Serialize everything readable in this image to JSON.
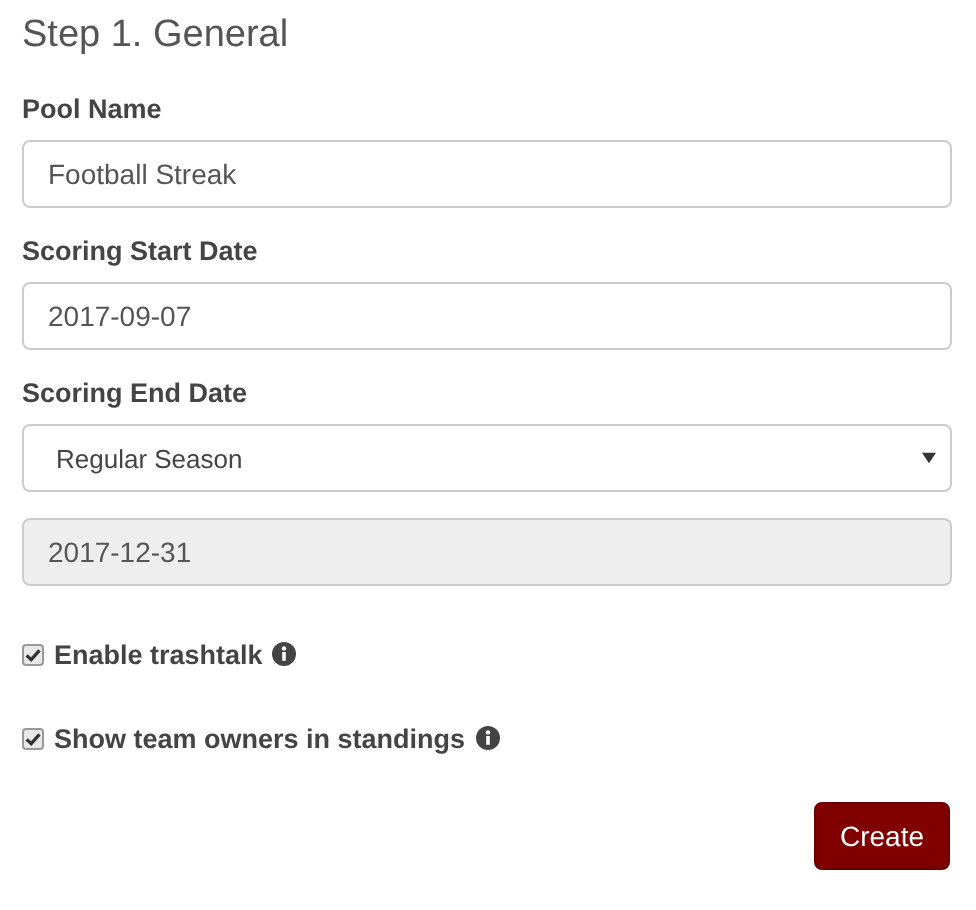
{
  "title": "Step 1. General",
  "fields": [
    {
      "label": "Pool Name",
      "kind": "text",
      "value": "Football Streak",
      "disabled": false
    },
    {
      "label": "Scoring Start Date",
      "kind": "text",
      "value": "2017-09-07",
      "disabled": false
    },
    {
      "label": "Scoring End Date",
      "kind": "select",
      "value": "Regular Season",
      "disabled": false
    },
    {
      "kind": "text",
      "value": "2017-12-31",
      "disabled": true
    }
  ],
  "options": [
    {
      "label": "Enable trashtalk",
      "checked": true
    },
    {
      "label": "Show team owners in standings",
      "checked": true
    }
  ],
  "button": "Create"
}
